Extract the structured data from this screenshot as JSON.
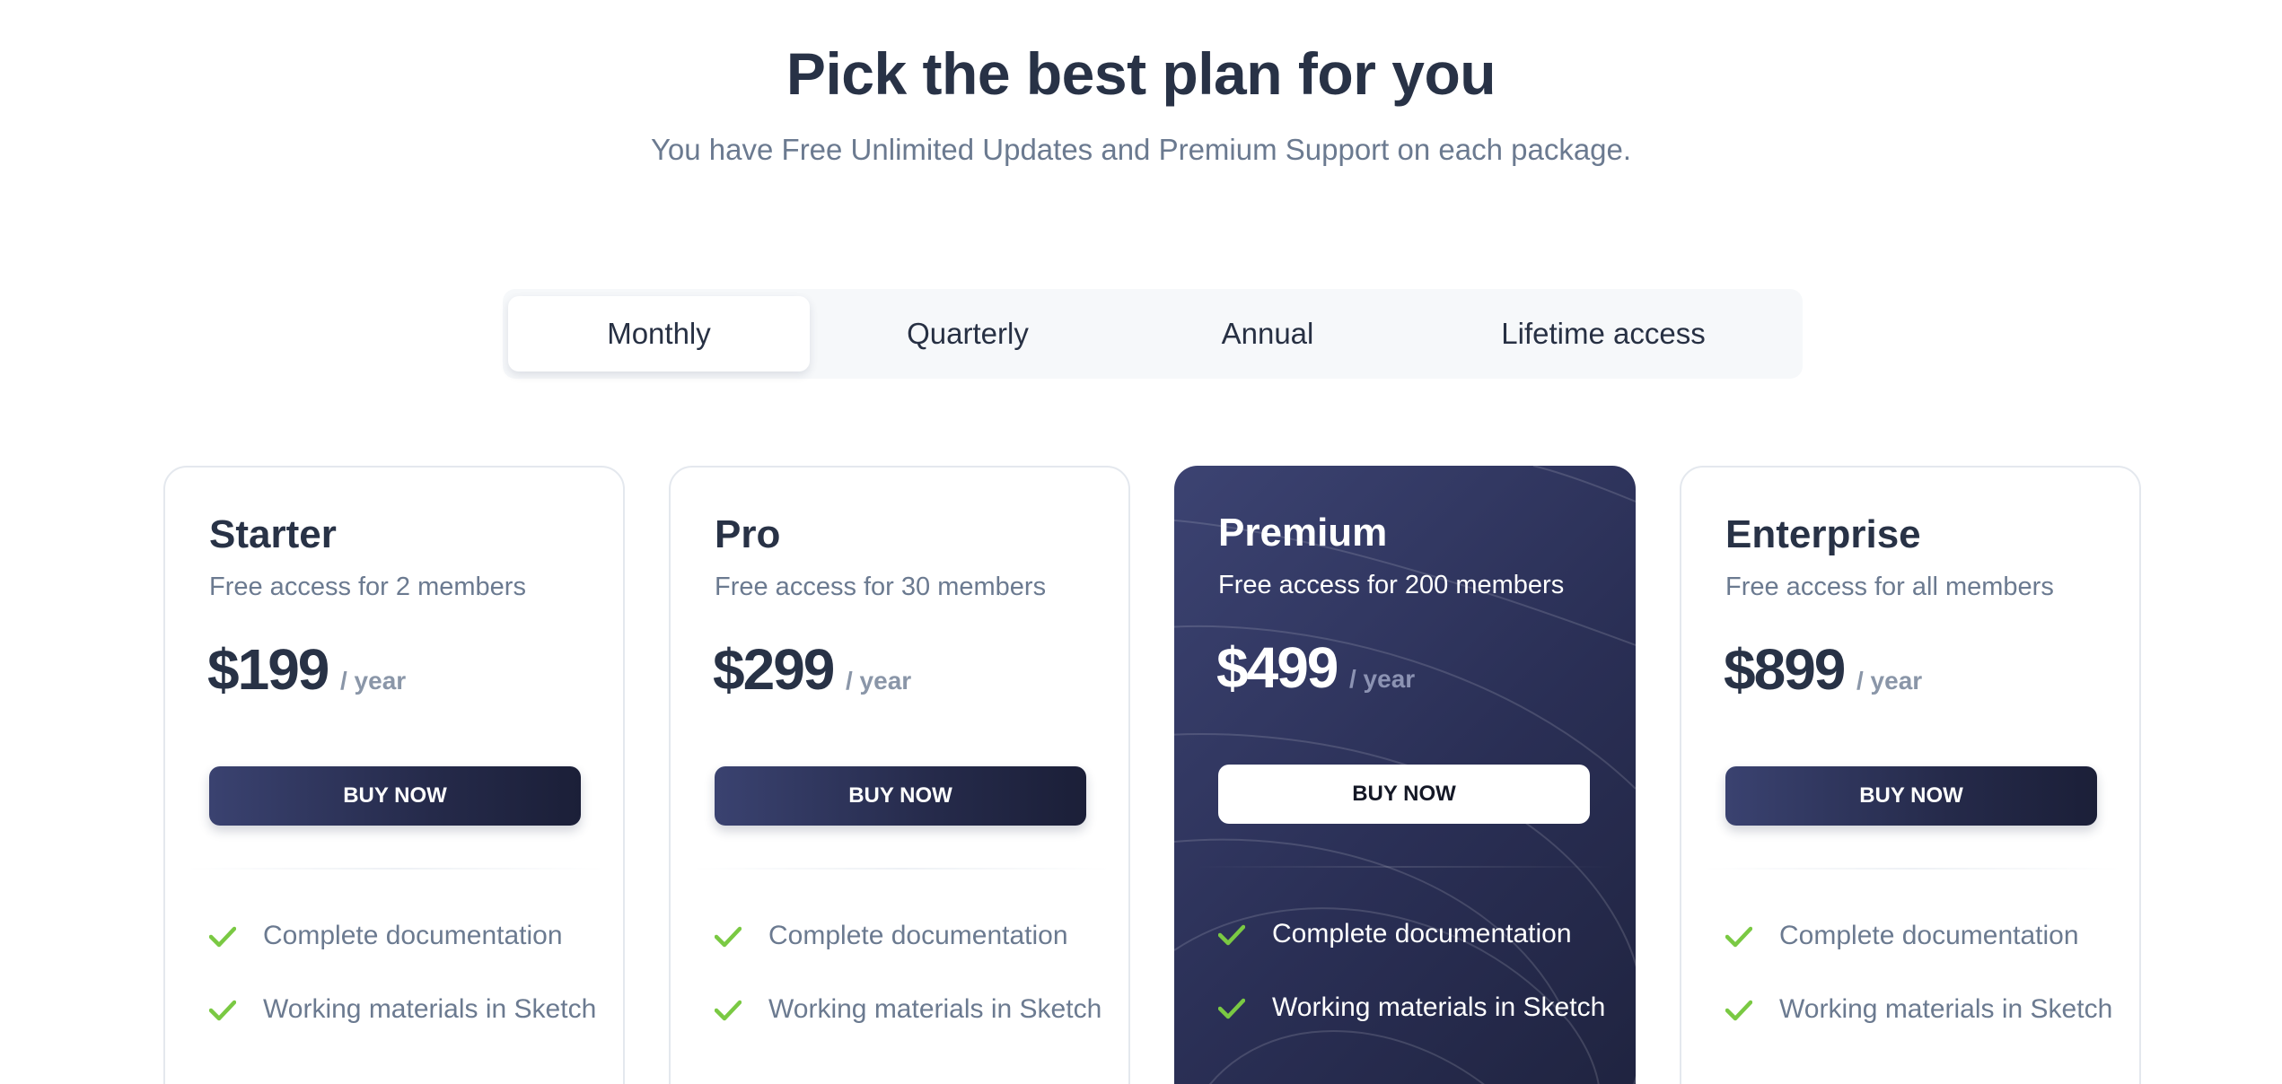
{
  "header": {
    "title": "Pick the best plan for you",
    "subtitle": "You have Free Unlimited Updates and Premium Support on each package."
  },
  "billing_tabs": [
    {
      "label": "Monthly",
      "active": true
    },
    {
      "label": "Quarterly",
      "active": false
    },
    {
      "label": "Annual",
      "active": false
    },
    {
      "label": "Lifetime access",
      "active": false
    }
  ],
  "plans": [
    {
      "name": "Starter",
      "description": "Free access for 2 members",
      "price": "$199",
      "period": "/ year",
      "button_label": "BUY NOW",
      "features": [
        "Complete documentation",
        "Working materials in Sketch"
      ]
    },
    {
      "name": "Pro",
      "description": "Free access for 30 members",
      "price": "$299",
      "period": "/ year",
      "button_label": "BUY NOW",
      "features": [
        "Complete documentation",
        "Working materials in Sketch"
      ]
    },
    {
      "name": "Premium",
      "description": "Free access for 200 members",
      "price": "$499",
      "period": "/ year",
      "button_label": "BUY NOW",
      "highlighted": true,
      "features": [
        "Complete documentation",
        "Working materials in Sketch"
      ]
    },
    {
      "name": "Enterprise",
      "description": "Free access for all members",
      "price": "$899",
      "period": "/ year",
      "button_label": "BUY NOW",
      "features": [
        "Complete documentation",
        "Working materials in Sketch"
      ]
    }
  ],
  "icons": {
    "feature_bullet": "check-icon"
  },
  "colors": {
    "heading": "#283246",
    "muted_text": "#6b7a90",
    "check": "#7ac943",
    "premium_bg": "#2a2f55",
    "button_dark": "#252a4a"
  }
}
